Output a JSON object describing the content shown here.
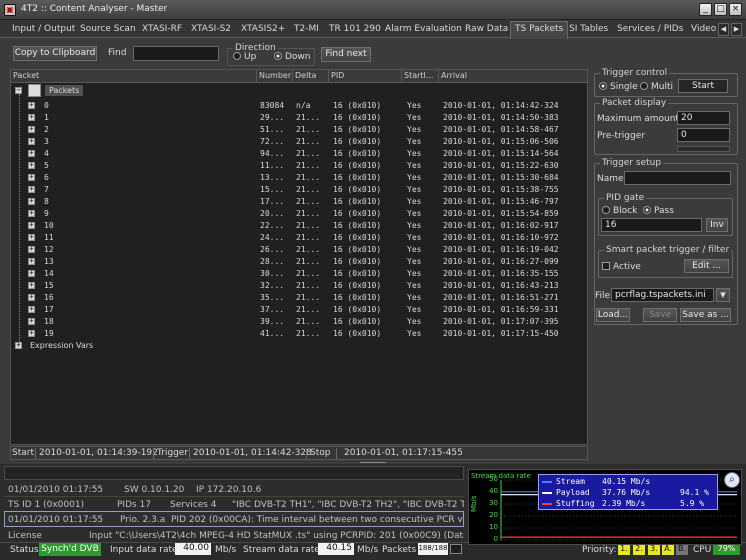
{
  "window": {
    "title": "4T2 :: Content Analyser - Master",
    "buttons": [
      "_",
      "□",
      "×"
    ]
  },
  "tabs": [
    "Input / Output",
    "Source Scan",
    "XTASI-RF",
    "XTASI-S2",
    "XTASIS2+",
    "T2-MI",
    "TR 101 290",
    "Alarm Evaluation",
    "Raw Data",
    "TS Packets",
    "SI Tables",
    "Services / PIDs",
    "Video"
  ],
  "active_tab": "TS Packets",
  "toolbar": {
    "copy_label": "Copy to Clipboard",
    "find_label": "Find",
    "find_value": "",
    "direction_label": "Direction",
    "up_label": "Up",
    "down_label": "Down",
    "find_next_label": "Find next"
  },
  "table": {
    "columns": [
      "Packet",
      "Number",
      "Delta",
      "PID",
      "Startl...",
      "Arrival"
    ],
    "root_label": "Packets",
    "rows": [
      {
        "idx": "0",
        "number": "83084",
        "delta": "n/a",
        "pid": "16 (0x010)",
        "start": "Yes",
        "arrival": "2010-01-01, 01:14:42-324"
      },
      {
        "idx": "1",
        "number": "29...",
        "delta": "21...",
        "pid": "16 (0x010)",
        "start": "Yes",
        "arrival": "2010-01-01, 01:14:50-383"
      },
      {
        "idx": "2",
        "number": "51...",
        "delta": "21...",
        "pid": "16 (0x010)",
        "start": "Yes",
        "arrival": "2010-01-01, 01:14:58-467"
      },
      {
        "idx": "3",
        "number": "72...",
        "delta": "21...",
        "pid": "16 (0x010)",
        "start": "Yes",
        "arrival": "2010-01-01, 01:15:06-506"
      },
      {
        "idx": "4",
        "number": "94...",
        "delta": "21...",
        "pid": "16 (0x010)",
        "start": "Yes",
        "arrival": "2010-01-01, 01:15:14-564"
      },
      {
        "idx": "5",
        "number": "11...",
        "delta": "21...",
        "pid": "16 (0x010)",
        "start": "Yes",
        "arrival": "2010-01-01, 01:15:22-630"
      },
      {
        "idx": "6",
        "number": "13...",
        "delta": "21...",
        "pid": "16 (0x010)",
        "start": "Yes",
        "arrival": "2010-01-01, 01:15:30-684"
      },
      {
        "idx": "7",
        "number": "15...",
        "delta": "21...",
        "pid": "16 (0x010)",
        "start": "Yes",
        "arrival": "2010-01-01, 01:15:38-755"
      },
      {
        "idx": "8",
        "number": "17...",
        "delta": "21...",
        "pid": "16 (0x010)",
        "start": "Yes",
        "arrival": "2010-01-01, 01:15:46-797"
      },
      {
        "idx": "9",
        "number": "20...",
        "delta": "21...",
        "pid": "16 (0x010)",
        "start": "Yes",
        "arrival": "2010-01-01, 01:15:54-859"
      },
      {
        "idx": "10",
        "number": "22...",
        "delta": "21...",
        "pid": "16 (0x010)",
        "start": "Yes",
        "arrival": "2010-01-01, 01:16:02-917"
      },
      {
        "idx": "11",
        "number": "24...",
        "delta": "21...",
        "pid": "16 (0x010)",
        "start": "Yes",
        "arrival": "2010-01-01, 01:16:10-972"
      },
      {
        "idx": "12",
        "number": "26...",
        "delta": "21...",
        "pid": "16 (0x010)",
        "start": "Yes",
        "arrival": "2010-01-01, 01:16:19-042"
      },
      {
        "idx": "13",
        "number": "28...",
        "delta": "21...",
        "pid": "16 (0x010)",
        "start": "Yes",
        "arrival": "2010-01-01, 01:16:27-099"
      },
      {
        "idx": "14",
        "number": "30...",
        "delta": "21...",
        "pid": "16 (0x010)",
        "start": "Yes",
        "arrival": "2010-01-01, 01:16:35-155"
      },
      {
        "idx": "15",
        "number": "32...",
        "delta": "21...",
        "pid": "16 (0x010)",
        "start": "Yes",
        "arrival": "2010-01-01, 01:16:43-213"
      },
      {
        "idx": "16",
        "number": "35...",
        "delta": "21...",
        "pid": "16 (0x010)",
        "start": "Yes",
        "arrival": "2010-01-01, 01:16:51-271"
      },
      {
        "idx": "17",
        "number": "37...",
        "delta": "21...",
        "pid": "16 (0x010)",
        "start": "Yes",
        "arrival": "2010-01-01, 01:16:59-331"
      },
      {
        "idx": "18",
        "number": "39...",
        "delta": "21...",
        "pid": "16 (0x010)",
        "start": "Yes",
        "arrival": "2010-01-01, 01:17:07-395"
      },
      {
        "idx": "19",
        "number": "41...",
        "delta": "21...",
        "pid": "16 (0x010)",
        "start": "Yes",
        "arrival": "2010-01-01, 01:17:15-450"
      }
    ],
    "expression_label": "Expression Vars"
  },
  "statusline": {
    "start_label": "Start",
    "start_value": "2010-01-01, 01:14:39-192",
    "trigger_label": "Trigger",
    "trigger_value": "2010-01-01, 01:14:42-328",
    "stop_label": "Stop",
    "stop_value": "2010-01-01, 01:17:15-455"
  },
  "trigger_control": {
    "title": "Trigger control",
    "single": "Single",
    "multi": "Multi",
    "start": "Start"
  },
  "packet_display": {
    "title": "Packet display",
    "max_label": "Maximum amount",
    "max_value": "20",
    "pre_label": "Pre-trigger",
    "pre_value": "0"
  },
  "trigger_setup": {
    "title": "Trigger setup",
    "name_label": "Name",
    "name_value": "",
    "pid_gate": {
      "title": "PID gate",
      "block": "Block",
      "pass": "Pass",
      "value": "16",
      "inv": "Inv"
    },
    "smart": {
      "title": "Smart packet trigger / filter",
      "active": "Active",
      "edit": "Edit ..."
    },
    "file_label": "File",
    "file_value": "pcrflag.tspackets.ini",
    "load": "Load...",
    "save": "Save",
    "save_as": "Save as ..."
  },
  "log": {
    "row1": {
      "date": "01/01/2010 01:17:55",
      "sw": "SW 0.10.1.20",
      "ip": "IP 172.20.10.6"
    },
    "row2": {
      "ts": "TS  ID 1 (0x0001)",
      "pids": "PIDs 17",
      "services": "Services 4",
      "names": "\"IBC DVB-T2 TH1\", \"IBC DVB-T2 TH2\", \"IBC DVB-T2 TH"
    },
    "row3": {
      "date": "01/01/2010 01:17:55",
      "prio": "Prio. 2.3.a",
      "msg": "PID 202 (0x00CA): Time interval between two consecutive PCR values"
    },
    "license": {
      "label": "License",
      "text": "Input \"C:\\Users\\4T2\\4ch MPEG-4 HD StatMUX .ts\" using PCRPID: 201 (0x00C9) (Data rat"
    }
  },
  "statusbar": {
    "status_label": "Status",
    "status_value": "Synch'd DVB",
    "input_label": "Input data rate",
    "input_value": "40.00",
    "input_unit": "Mb/s",
    "stream_label": "Stream data rate",
    "stream_value": "40.15",
    "stream_unit": "Mb/s",
    "packets_label": "Packets",
    "packets_value": "188/188",
    "priority_label": "Priority:",
    "priorities": [
      "1.",
      "2.",
      "3.",
      "A.",
      "B."
    ],
    "cpu_label": "CPU",
    "cpu_value": "79%"
  },
  "chart_data": {
    "type": "line",
    "title": "Stream data rate",
    "ylabel": "Mb/s",
    "yticks": [
      "50",
      "40",
      "30",
      "20",
      "10",
      "0"
    ],
    "ylim": [
      0,
      50
    ],
    "legend": [
      {
        "name": "Stream",
        "value": "40.15 Mb/s",
        "pct": "",
        "color": "#4a7cff"
      },
      {
        "name": "Payload",
        "value": "37.76 Mb/s",
        "pct": "94.1 %",
        "color": "#ffffff"
      },
      {
        "name": "Stuffing",
        "value": "2.39 Mb/s",
        "pct": "5.9 %",
        "color": "#ff3b3b"
      }
    ],
    "series": [
      {
        "name": "Stream",
        "values": [
          40.15,
          40.15,
          40.15,
          40.15,
          40.15,
          40.15,
          40.15,
          40.15
        ]
      },
      {
        "name": "Payload",
        "values": [
          37.76,
          37.76,
          37.76,
          37.76,
          37.76,
          37.76,
          37.76,
          37.76
        ]
      },
      {
        "name": "Stuffing",
        "values": [
          2.39,
          2.39,
          2.39,
          2.39,
          2.39,
          2.39,
          2.39,
          2.39
        ]
      }
    ]
  }
}
